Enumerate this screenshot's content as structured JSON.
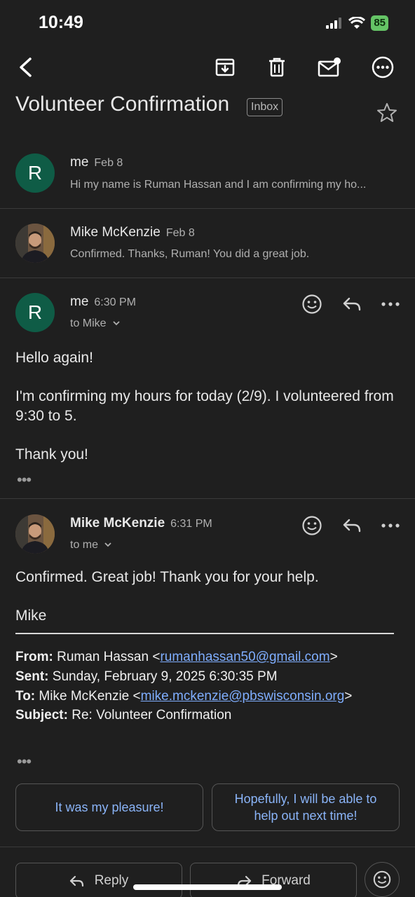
{
  "status_bar": {
    "time": "10:49",
    "battery": "85"
  },
  "thread": {
    "subject": "Volunteer Confirmation",
    "label": "Inbox"
  },
  "messages": [
    {
      "sender": "me",
      "date": "Feb 8",
      "avatar_letter": "R",
      "snippet": "Hi my name is Ruman Hassan and I am confirming my ho..."
    },
    {
      "sender": "Mike McKenzie",
      "date": "Feb 8",
      "snippet": "Confirmed. Thanks, Ruman! You did a great job."
    },
    {
      "sender": "me",
      "date": "6:30 PM",
      "avatar_letter": "R",
      "to": "to Mike",
      "body": [
        "Hello again!",
        "I'm confirming my hours for today (2/9). I volunteered from 9:30 to 5.",
        "Thank you!"
      ]
    },
    {
      "sender": "Mike McKenzie",
      "date": "6:31 PM",
      "to": "to me",
      "body": [
        "Confirmed. Great job! Thank you for your help.",
        "Mike"
      ],
      "quoted": {
        "from_label": "From:",
        "from_name": "Ruman Hassan <",
        "from_email": "rumanhassan50@gmail.com",
        "from_end": ">",
        "sent_label": "Sent:",
        "sent_value": "Sunday, February 9, 2025 6:30:35 PM",
        "to_label": "To:",
        "to_name": "Mike McKenzie <",
        "to_email": "mike.mckenzie@pbswisconsin.org",
        "to_end": ">",
        "subject_label": "Subject:",
        "subject_value": "Re: Volunteer Confirmation"
      }
    }
  ],
  "smart_replies": [
    "It was my pleasure!",
    "Hopefully, I will be able to help out next time!"
  ],
  "bottom_actions": {
    "reply": "Reply",
    "forward": "Forward"
  },
  "colors": {
    "background": "#1f1f1f",
    "avatar_green": "#0f5c46",
    "link": "#7faeff",
    "smart_reply_text": "#8ab4f8"
  }
}
